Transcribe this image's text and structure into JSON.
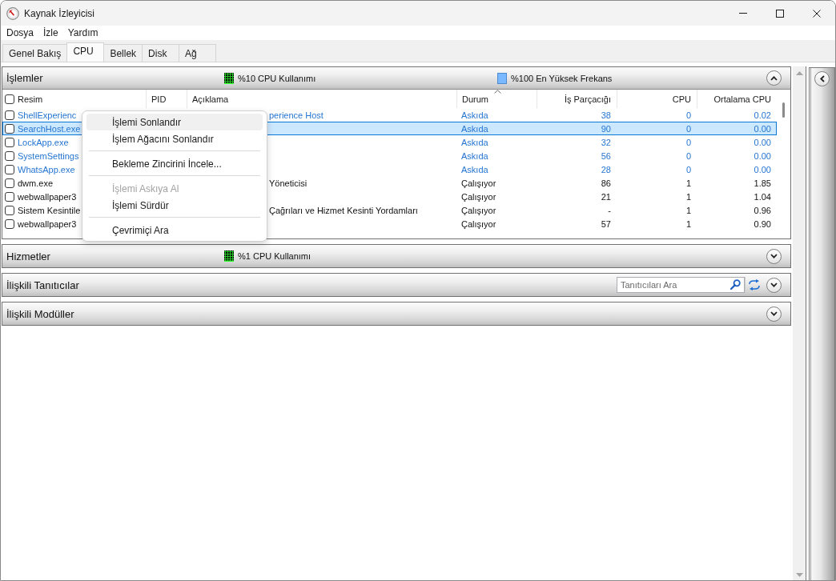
{
  "window": {
    "title": "Kaynak İzleyicisi"
  },
  "menu_bar": [
    {
      "label": "Dosya"
    },
    {
      "label": "İzle"
    },
    {
      "label": "Yardım"
    }
  ],
  "tabs": [
    {
      "label": "Genel Bakış",
      "selected": false
    },
    {
      "label": "CPU",
      "selected": true
    },
    {
      "label": "Bellek",
      "selected": false
    },
    {
      "label": "Disk",
      "selected": false
    },
    {
      "label": "Ağ",
      "selected": false
    }
  ],
  "panels": [
    {
      "title": "İşlemler",
      "expanded": true,
      "indicators": [
        {
          "kind": "usage",
          "label": "%10 CPU Kullanımı"
        },
        {
          "kind": "frequency",
          "label": "%100 En Yüksek Frekans"
        }
      ],
      "table": {
        "header_checkbox": {
          "checked": false
        },
        "columns": [
          {
            "label": "Resim",
            "sorted": false
          },
          {
            "label": "PID",
            "sorted": false
          },
          {
            "label": "Açıklama",
            "sorted": false
          },
          {
            "label": "Durum",
            "sorted": true
          },
          {
            "label": "İş Parçacığı",
            "sorted": false
          },
          {
            "label": "CPU",
            "sorted": false
          },
          {
            "label": "Ortalama CPU",
            "sorted": false
          }
        ],
        "rows": [
          {
            "checked": false,
            "selected": false,
            "suspended": true,
            "image": "ShellExperienc",
            "description": "perience Host",
            "status": "Askıda",
            "threads": "38",
            "cpu": "0",
            "average_cpu": "0.02"
          },
          {
            "checked": false,
            "selected": true,
            "suspended": true,
            "image": "SearchHost.exe",
            "status": "Askıda",
            "threads": "90",
            "cpu": "0",
            "average_cpu": "0.00"
          },
          {
            "checked": false,
            "selected": false,
            "suspended": true,
            "image": "LockApp.exe",
            "status": "Askıda",
            "threads": "32",
            "cpu": "0",
            "average_cpu": "0.00"
          },
          {
            "checked": false,
            "selected": false,
            "suspended": true,
            "image": "SystemSettings",
            "status": "Askıda",
            "threads": "56",
            "cpu": "0",
            "average_cpu": "0.00"
          },
          {
            "checked": false,
            "selected": false,
            "suspended": true,
            "image": "WhatsApp.exe",
            "status": "Askıda",
            "threads": "28",
            "cpu": "0",
            "average_cpu": "0.00"
          },
          {
            "checked": false,
            "selected": false,
            "suspended": false,
            "image": "dwm.exe",
            "description": "Yöneticisi",
            "status": "Çalışıyor",
            "threads": "86",
            "cpu": "1",
            "average_cpu": "1.85"
          },
          {
            "checked": false,
            "selected": false,
            "suspended": false,
            "image": "webwallpaper3",
            "status": "Çalışıyor",
            "threads": "21",
            "cpu": "1",
            "average_cpu": "1.04"
          },
          {
            "checked": false,
            "selected": false,
            "suspended": false,
            "image": "Sistem Kesintile",
            "description": "Çağrıları ve Hizmet Kesinti Yordamları",
            "status": "Çalışıyor",
            "threads": "-",
            "cpu": "1",
            "average_cpu": "0.96"
          },
          {
            "checked": false,
            "selected": false,
            "suspended": false,
            "image": "webwallpaper3",
            "status": "Çalışıyor",
            "threads": "57",
            "cpu": "1",
            "average_cpu": "0.90"
          }
        ]
      }
    },
    {
      "title": "Hizmetler",
      "expanded": false,
      "indicators": [
        {
          "kind": "usage",
          "label": "%1 CPU Kullanımı"
        }
      ]
    },
    {
      "title": "İlişkili Tanıtıcılar",
      "expanded": false,
      "search": {
        "placeholder": "Tanıtıcıları Ara"
      }
    },
    {
      "title": "İlişkili Modüller",
      "expanded": false
    }
  ],
  "context_menu": {
    "items": [
      {
        "kind": "item",
        "label": "İşlemi Sonlandır",
        "selected": true,
        "disabled": false
      },
      {
        "kind": "item",
        "label": "İşlem Ağacını Sonlandır",
        "selected": false,
        "disabled": false
      },
      {
        "kind": "separator"
      },
      {
        "kind": "item",
        "label": "Bekleme Zincirini İncele...",
        "selected": false,
        "disabled": false
      },
      {
        "kind": "separator"
      },
      {
        "kind": "item",
        "label": "İşlemi Askıya Al",
        "selected": false,
        "disabled": true
      },
      {
        "kind": "item",
        "label": "İşlemi Sürdür",
        "selected": false,
        "disabled": false
      },
      {
        "kind": "separator"
      },
      {
        "kind": "item",
        "label": "Çevrimiçi Ara",
        "selected": false,
        "disabled": false
      }
    ]
  }
}
